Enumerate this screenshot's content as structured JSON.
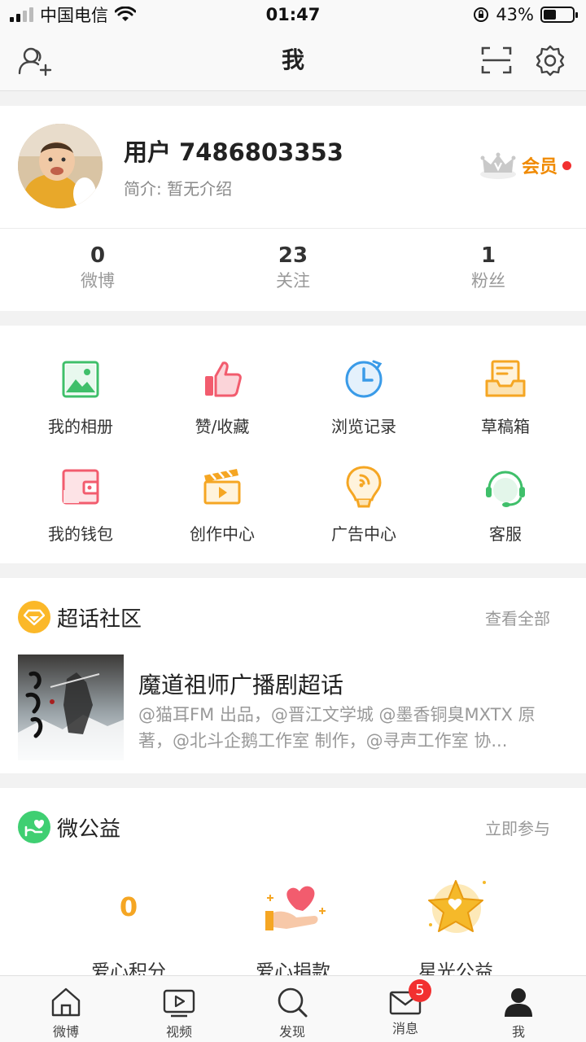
{
  "status_bar": {
    "carrier": "中国电信",
    "time": "01:47",
    "battery": "43%",
    "battery_level": 0.43
  },
  "nav": {
    "title": "我",
    "icons": [
      "add-friend-icon",
      "scan-icon",
      "settings-icon"
    ]
  },
  "profile": {
    "username": "用户 7486803353",
    "bio": "简介: 暂无介绍",
    "vip_label": "会员",
    "stats": [
      {
        "value": "0",
        "label": "微博"
      },
      {
        "value": "23",
        "label": "关注"
      },
      {
        "value": "1",
        "label": "粉丝"
      }
    ]
  },
  "tools": [
    {
      "label": "我的相册",
      "icon": "album-icon",
      "color": "#3fbf6a"
    },
    {
      "label": "赞/收藏",
      "icon": "like-icon",
      "color": "#f25c6e"
    },
    {
      "label": "浏览记录",
      "icon": "history-icon",
      "color": "#3a9be8"
    },
    {
      "label": "草稿箱",
      "icon": "drafts-icon",
      "color": "#f5a623"
    },
    {
      "label": "我的钱包",
      "icon": "wallet-icon",
      "color": "#f25c6e"
    },
    {
      "label": "创作中心",
      "icon": "creator-icon",
      "color": "#f5a623"
    },
    {
      "label": "广告中心",
      "icon": "ad-icon",
      "color": "#f5a623"
    },
    {
      "label": "客服",
      "icon": "customer-service-icon",
      "color": "#3fbf6a"
    }
  ],
  "super_topic": {
    "title": "超话社区",
    "link": "查看全部",
    "topic_name": "魔道祖师广播剧超话",
    "topic_desc": "@猫耳FM 出品，@晋江文学城 @墨香铜臭MXTX 原著，@北斗企鹅工作室 制作，@寻声工作室 协..."
  },
  "charity": {
    "title": "微公益",
    "link": "立即参与",
    "items": [
      {
        "value": "0",
        "label": "爱心积分"
      },
      {
        "label": "爱心捐款",
        "icon": "donation-heart-icon"
      },
      {
        "label": "星光公益",
        "icon": "star-badge-icon"
      }
    ]
  },
  "tabbar": {
    "tabs": [
      {
        "label": "微博",
        "icon": "home-icon"
      },
      {
        "label": "视频",
        "icon": "video-icon"
      },
      {
        "label": "发现",
        "icon": "discover-search-icon"
      },
      {
        "label": "消息",
        "icon": "message-icon",
        "badge": "5"
      },
      {
        "label": "我",
        "icon": "profile-icon",
        "active": true
      }
    ]
  }
}
